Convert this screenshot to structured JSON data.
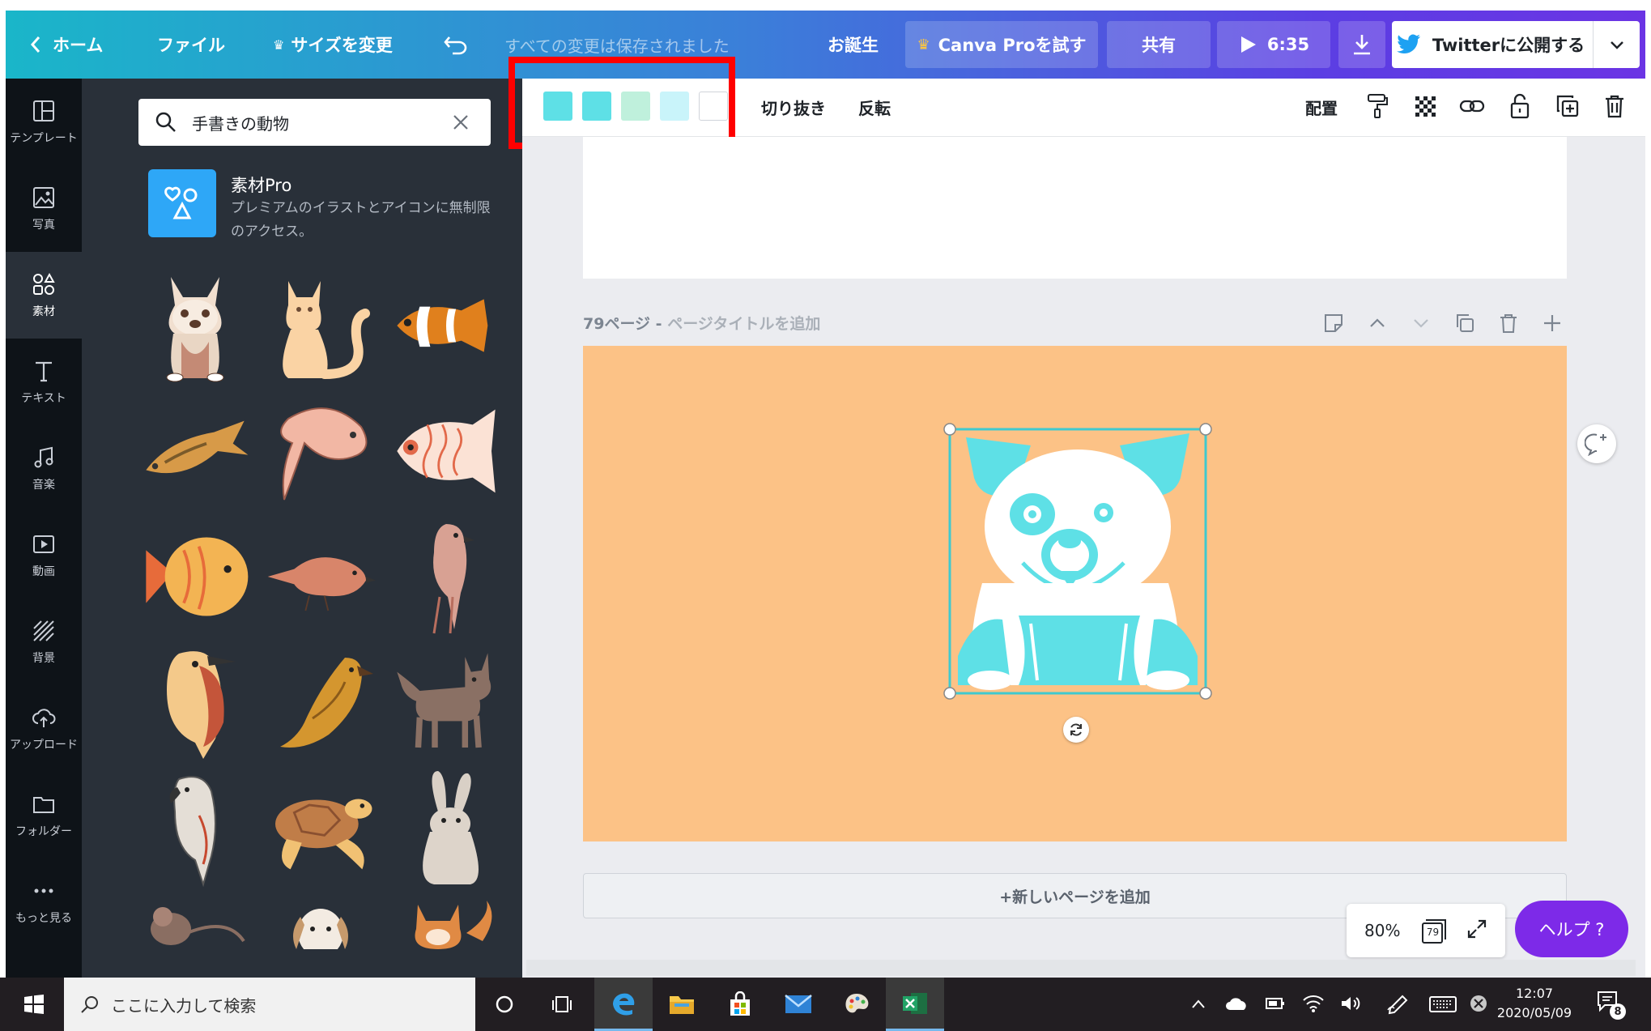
{
  "header": {
    "home": "ホーム",
    "file": "ファイル",
    "resize": "サイズを変更",
    "saved": "すべての変更は保存されました",
    "birthday": "お誕生",
    "try_pro": "Canva Proを試す",
    "share": "共有",
    "play_time": "6:35",
    "publish": "Twitterに公開する"
  },
  "rail": [
    {
      "label": "テンプレート",
      "icon": "template-icon"
    },
    {
      "label": "写真",
      "icon": "photo-icon"
    },
    {
      "label": "素材",
      "icon": "elements-icon"
    },
    {
      "label": "テキスト",
      "icon": "text-icon"
    },
    {
      "label": "音楽",
      "icon": "music-icon"
    },
    {
      "label": "動画",
      "icon": "video-icon"
    },
    {
      "label": "背景",
      "icon": "background-icon"
    },
    {
      "label": "アップロード",
      "icon": "upload-icon"
    },
    {
      "label": "フォルダー",
      "icon": "folder-icon"
    },
    {
      "label": "もっと見る",
      "icon": "more-icon"
    }
  ],
  "panel": {
    "search_value": "手書きの動物",
    "pro_title": "素材Pro",
    "pro_desc": "プレミアムのイラストとアイコンに無制限のアクセス。"
  },
  "toolbar": {
    "swatches": [
      "#5ee0e6",
      "#5ee0e6",
      "#bff0dc",
      "#c9f4fa",
      "#ffffff"
    ],
    "crop": "切り抜き",
    "flip": "反転",
    "arrange": "配置"
  },
  "canvas": {
    "page_number": "79ページ - ",
    "page_title_placeholder": "ページタイトルを追加",
    "page_bg": "#fcc286",
    "add_page": "+新しいページを追加",
    "zoom": "80%",
    "page_count": "79",
    "help": "ヘルプ ?"
  },
  "taskbar": {
    "search_placeholder": "ここに入力して検索",
    "time": "12:07",
    "date": "2020/05/09",
    "notifications": "8"
  }
}
